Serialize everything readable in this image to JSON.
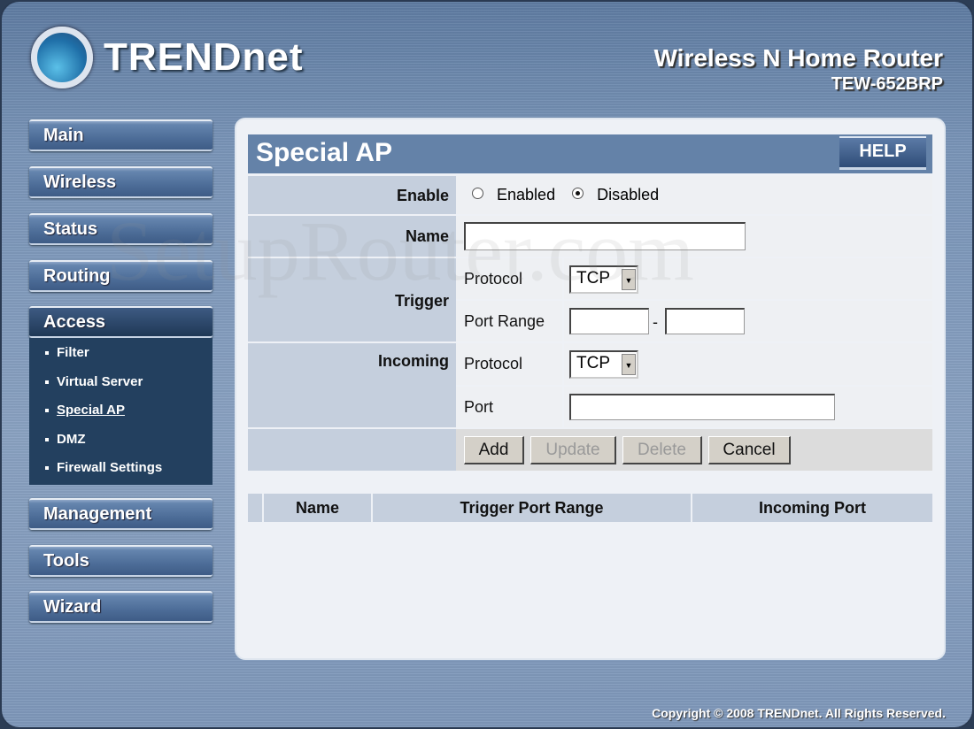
{
  "header": {
    "brand": "TRENDnet",
    "product": "Wireless N Home Router",
    "model": "TEW-652BRP"
  },
  "nav": {
    "items": [
      "Main",
      "Wireless",
      "Status",
      "Routing",
      "Access",
      "Management",
      "Tools",
      "Wizard"
    ],
    "active": "Access",
    "access_sub": [
      "Filter",
      "Virtual Server",
      "Special AP",
      "DMZ",
      "Firewall Settings"
    ],
    "current_sub": "Special AP"
  },
  "page": {
    "title": "Special AP",
    "help_label": "HELP"
  },
  "form": {
    "enable_label": "Enable",
    "enabled_option": "Enabled",
    "disabled_option": "Disabled",
    "enable_value": "Disabled",
    "name_label": "Name",
    "name_value": "",
    "trigger_label": "Trigger",
    "trigger_protocol_label": "Protocol",
    "trigger_protocol_value": "TCP",
    "port_range_label": "Port Range",
    "port_range_start": "",
    "port_range_sep": "-",
    "port_range_end": "",
    "incoming_label": "Incoming",
    "incoming_protocol_label": "Protocol",
    "incoming_protocol_value": "TCP",
    "port_label": "Port",
    "port_value": "",
    "buttons": {
      "add": "Add",
      "update": "Update",
      "delete": "Delete",
      "cancel": "Cancel"
    }
  },
  "table": {
    "columns": [
      "Name",
      "Trigger Port Range",
      "Incoming Port"
    ],
    "rows": []
  },
  "watermark": "SetupRouter.com",
  "footer": {
    "copyright": "Copyright © 2008 TRENDnet. All Rights Reserved."
  },
  "colors": {
    "title_bar": "#6482a8",
    "label_column": "#c5cfdd",
    "nav_active": "#23405f"
  }
}
